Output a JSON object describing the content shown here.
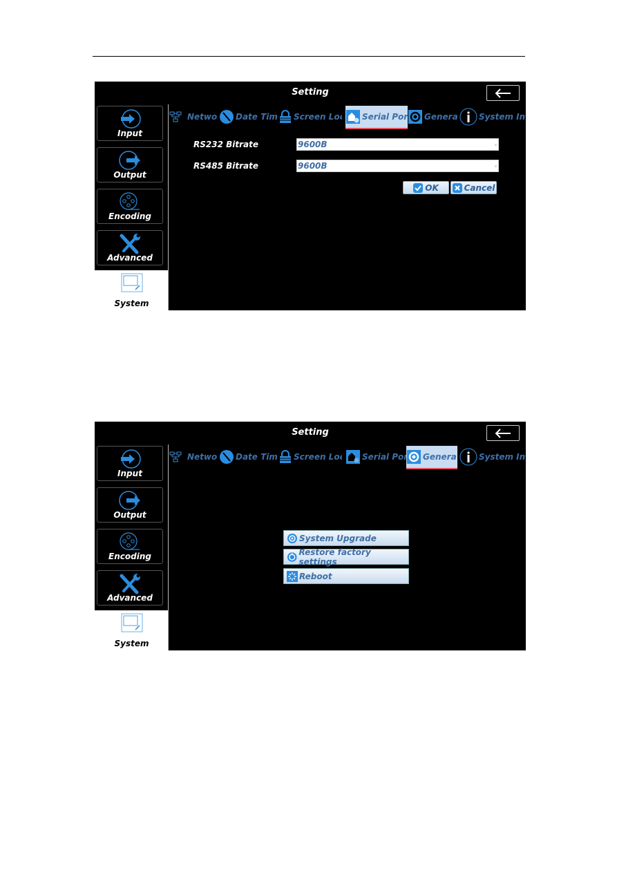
{
  "screens": [
    {
      "title": "Setting",
      "sidebar": [
        {
          "label": "Input",
          "icon": "input-arrow-icon"
        },
        {
          "label": "Output",
          "icon": "output-arrow-icon"
        },
        {
          "label": "Encoding",
          "icon": "film-reel-icon"
        },
        {
          "label": "Advanced",
          "icon": "wrench-screwdriver-icon"
        },
        {
          "label": "System",
          "icon": "system-window-icon",
          "active": true
        }
      ],
      "tabs": [
        {
          "label": "Networ",
          "icon": "network-icon"
        },
        {
          "label": "Date Tim",
          "icon": "clock-icon"
        },
        {
          "label": "Screen Loc",
          "icon": "lock-icon"
        },
        {
          "label": "Serial Por",
          "icon": "serial-port-icon",
          "active": true
        },
        {
          "label": "Genera",
          "icon": "gear-icon"
        },
        {
          "label": "System Inf",
          "icon": "info-icon"
        }
      ],
      "form": {
        "rs232_label": "RS232 Bitrate",
        "rs232_value": "9600B",
        "rs485_label": "RS485 Bitrate",
        "rs485_value": "9600B",
        "ok_label": "OK",
        "cancel_label": "Cancel"
      }
    },
    {
      "title": "Setting",
      "sidebar": [
        {
          "label": "Input",
          "icon": "input-arrow-icon"
        },
        {
          "label": "Output",
          "icon": "output-arrow-icon"
        },
        {
          "label": "Encoding",
          "icon": "film-reel-icon"
        },
        {
          "label": "Advanced",
          "icon": "wrench-screwdriver-icon"
        },
        {
          "label": "System",
          "icon": "system-window-icon",
          "active": true
        }
      ],
      "tabs": [
        {
          "label": "Networ",
          "icon": "network-icon"
        },
        {
          "label": "Date Tim",
          "icon": "clock-icon"
        },
        {
          "label": "Screen Loc",
          "icon": "lock-icon"
        },
        {
          "label": "Serial Por",
          "icon": "serial-port-icon"
        },
        {
          "label": "Genera",
          "icon": "gear-icon",
          "active": true
        },
        {
          "label": "System Inf",
          "icon": "info-icon"
        }
      ],
      "menu": [
        {
          "label": "System Upgrade",
          "icon": "upgrade-gear-icon"
        },
        {
          "label": "Restore factory settings",
          "icon": "restore-gear-icon"
        },
        {
          "label": "Reboot",
          "icon": "reboot-icon"
        }
      ]
    }
  ],
  "colors": {
    "accent_blue": "#2a8de0",
    "tab_text": "#3f6fa6",
    "active_tab_bg": "#c9dcf2",
    "active_tab_underline": "#e0505a"
  }
}
